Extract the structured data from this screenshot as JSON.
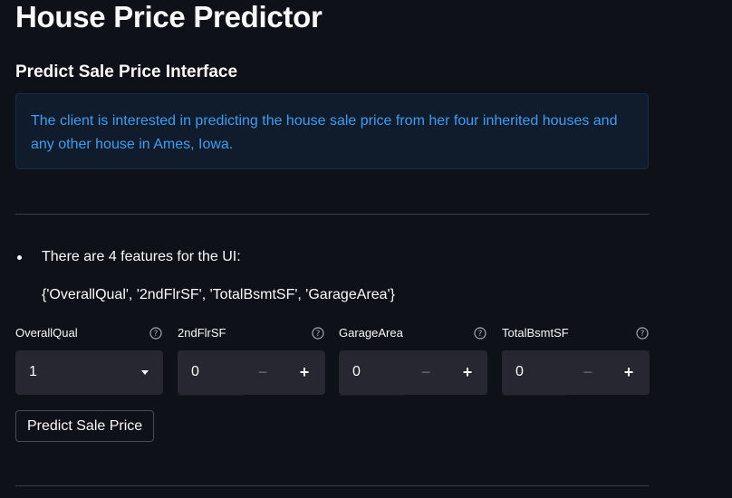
{
  "page": {
    "title": "House Price Predictor",
    "subtitle": "Predict Sale Price Interface",
    "info_text": "The client is interested in predicting the house sale price from her four inherited houses and any other house in Ames, Iowa.",
    "bullet_text": "There are 4 features for the UI:",
    "feature_set": "{'OverallQual', '2ndFlrSF', 'TotalBsmtSF', 'GarageArea'}"
  },
  "inputs": {
    "overall_qual": {
      "label": "OverallQual",
      "value": "1"
    },
    "second_flr_sf": {
      "label": "2ndFlrSF",
      "value": "0"
    },
    "garage_area": {
      "label": "GarageArea",
      "value": "0"
    },
    "total_bsmt_sf": {
      "label": "TotalBsmtSF",
      "value": "0"
    },
    "minus_symbol": "−",
    "plus_symbol": "+"
  },
  "actions": {
    "predict_label": "Predict Sale Price"
  },
  "icons": {
    "help": "help-circle-icon",
    "dropdown": "chevron-down-icon"
  },
  "colors": {
    "background": "#0e1117",
    "info_text": "#3d9df3",
    "info_bg": "#101c2c",
    "input_bg": "#262730"
  }
}
